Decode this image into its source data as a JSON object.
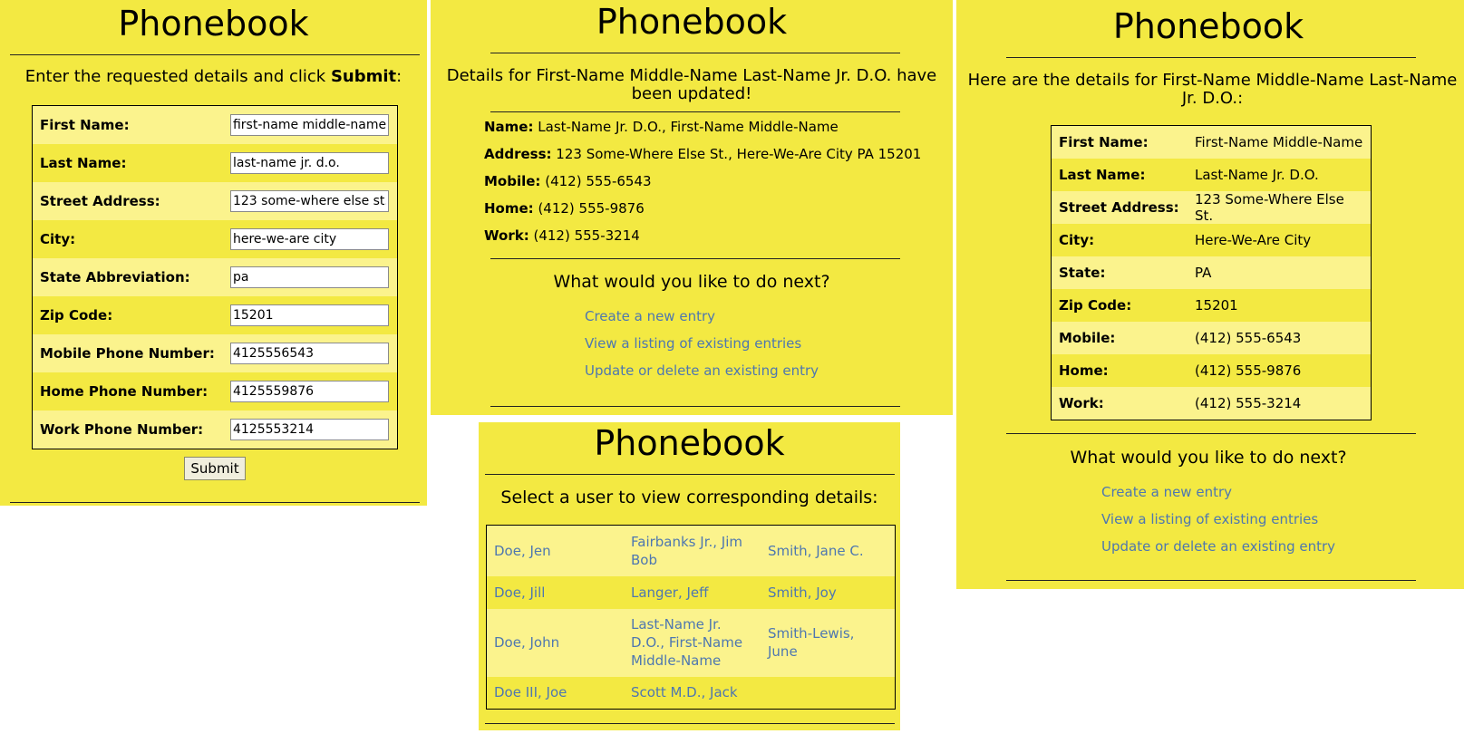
{
  "panel1": {
    "title": "Phonebook",
    "intro_text": "Enter the requested details and click ",
    "intro_bold": "Submit",
    "intro_end": ":",
    "fields": [
      {
        "label": "First Name:",
        "value": "first-name middle-name"
      },
      {
        "label": "Last Name:",
        "value": "last-name jr. d.o."
      },
      {
        "label": "Street Address:",
        "value": "123 some-where else st."
      },
      {
        "label": "City:",
        "value": "here-we-are city"
      },
      {
        "label": "State Abbreviation:",
        "value": "pa"
      },
      {
        "label": "Zip Code:",
        "value": "15201"
      },
      {
        "label": "Mobile Phone Number:",
        "value": "4125556543"
      },
      {
        "label": "Home Phone Number:",
        "value": "4125559876"
      },
      {
        "label": "Work Phone Number:",
        "value": "4125553214"
      }
    ],
    "submit_label": "Submit"
  },
  "panel2": {
    "title": "Phonebook",
    "message": "Details for First-Name Middle-Name Last-Name Jr. D.O. have been updated!",
    "details": [
      {
        "label": "Name:",
        "value": "Last-Name Jr. D.O., First-Name Middle-Name"
      },
      {
        "label": "Address:",
        "value": "123 Some-Where Else St., Here-We-Are City PA 15201"
      },
      {
        "label": "Mobile:",
        "value": "(412) 555-6543"
      },
      {
        "label": "Home:",
        "value": "(412) 555-9876"
      },
      {
        "label": "Work:",
        "value": "(412) 555-3214"
      }
    ],
    "next_heading": "What would you like to do next?",
    "links": [
      "Create a new entry",
      "View a listing of existing entries",
      "Update or delete an existing entry"
    ]
  },
  "panel3": {
    "title": "Phonebook",
    "intro": "Select a user to view corresponding details:",
    "rows": [
      [
        "Doe, Jen",
        "Fairbanks Jr., Jim Bob",
        "Smith, Jane C."
      ],
      [
        "Doe, Jill",
        "Langer, Jeff",
        "Smith, Joy"
      ],
      [
        "Doe, John",
        "Last-Name Jr. D.O., First-Name Middle-Name",
        "Smith-Lewis, June"
      ],
      [
        "Doe III, Joe",
        "Scott M.D., Jack",
        ""
      ]
    ]
  },
  "panel4": {
    "title": "Phonebook",
    "message": "Here are the details for First-Name Middle-Name Last-Name Jr. D.O.:",
    "details": [
      {
        "label": "First Name:",
        "value": "First-Name Middle-Name"
      },
      {
        "label": "Last Name:",
        "value": "Last-Name Jr. D.O."
      },
      {
        "label": "Street Address:",
        "value": "123 Some-Where Else St."
      },
      {
        "label": "City:",
        "value": "Here-We-Are City"
      },
      {
        "label": "State:",
        "value": "PA"
      },
      {
        "label": "Zip Code:",
        "value": "15201"
      },
      {
        "label": "Mobile:",
        "value": "(412) 555-6543"
      },
      {
        "label": "Home:",
        "value": "(412) 555-9876"
      },
      {
        "label": "Work:",
        "value": "(412) 555-3214"
      }
    ],
    "next_heading": "What would you like to do next?",
    "links": [
      "Create a new entry",
      "View a listing of existing entries",
      "Update or delete an existing entry"
    ]
  }
}
